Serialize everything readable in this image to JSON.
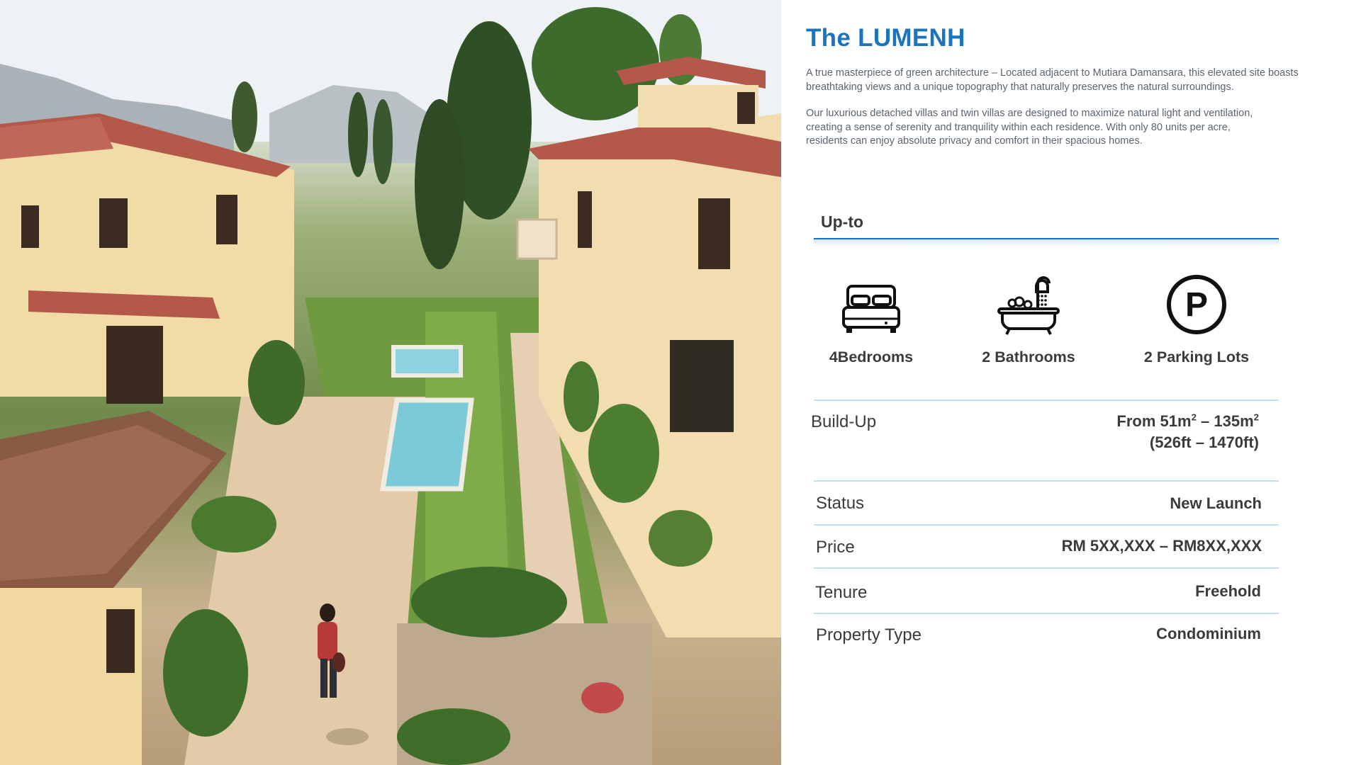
{
  "title": "The LUMENH",
  "intro": {
    "paragraph1": "A true masterpiece of green architecture – Located adjacent to Mutiara Damansara, this elevated site boasts breathtaking views and a unique topography that naturally preserves the natural surroundings.",
    "paragraph2": "Our luxurious detached villas and twin villas are designed to maximize natural light and ventilation, creating a sense of serenity and tranquility within each residence. With only 80 units per acre, residents can enjoy absolute privacy and comfort in their spacious homes."
  },
  "features": {
    "heading": "Up-to",
    "items": [
      {
        "icon": "bed-icon",
        "label": "4Bedrooms"
      },
      {
        "icon": "bathtub-icon",
        "label": "2 Bathrooms"
      },
      {
        "icon": "parking-icon",
        "label": "2 Parking Lots"
      }
    ]
  },
  "details": {
    "buildup_label": "Build-Up",
    "buildup_value_prefix": "From 51m",
    "buildup_value_sup1": "2",
    "buildup_value_mid": " – 135m",
    "buildup_value_sup2": "2",
    "buildup_value_line2": "(526ft – 1470ft)",
    "status_label": "Status",
    "status_value": "New Launch",
    "price_label": "Price",
    "price_value": "RM 5XX,XXX – RM8XX,XXX",
    "tenure_label": "Tenure",
    "tenure_value": "Freehold",
    "type_label": "Property Type",
    "type_value": "Condominium"
  },
  "colors": {
    "accent": "#1a74bf",
    "divider": "#bfe0f2",
    "text": "#3b3b3b"
  },
  "photo": {
    "subject": "villa-courtyard-photo"
  }
}
